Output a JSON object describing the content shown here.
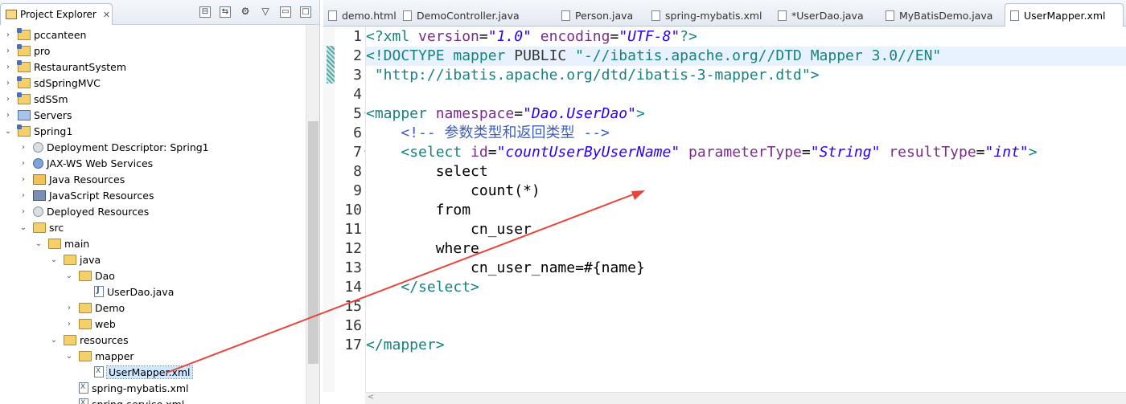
{
  "explorer": {
    "title": "Project Explorer",
    "close": "✕",
    "toolbar": {
      "collapse_all": "⊟",
      "link_editor": "⇆",
      "view_menu": "▽",
      "minimize": "▭",
      "maximize": "□"
    },
    "tree": [
      {
        "label": "pccanteen",
        "twisty": "›",
        "icon": "project"
      },
      {
        "label": "pro",
        "twisty": "›",
        "icon": "project"
      },
      {
        "label": "RestaurantSystem",
        "twisty": "›",
        "icon": "project"
      },
      {
        "label": "sdSpringMVC",
        "twisty": "›",
        "icon": "project"
      },
      {
        "label": "sdSSm",
        "twisty": "›",
        "icon": "project"
      },
      {
        "label": "Servers",
        "twisty": "›",
        "icon": "server"
      },
      {
        "label": "Spring1",
        "twisty": "⌄",
        "icon": "project"
      },
      {
        "label": "Deployment Descriptor: Spring1",
        "twisty": "›",
        "icon": "dep"
      },
      {
        "label": "JAX-WS Web Services",
        "twisty": "›",
        "icon": "globe"
      },
      {
        "label": "Java Resources",
        "twisty": "›",
        "icon": "coffee"
      },
      {
        "label": "JavaScript Resources",
        "twisty": "›",
        "icon": "js"
      },
      {
        "label": "Deployed Resources",
        "twisty": "›",
        "icon": "dep"
      },
      {
        "label": "src",
        "twisty": "⌄",
        "icon": "folder"
      },
      {
        "label": "main",
        "twisty": "⌄",
        "icon": "folder"
      },
      {
        "label": "java",
        "twisty": "⌄",
        "icon": "folder"
      },
      {
        "label": "Dao",
        "twisty": "⌄",
        "icon": "folder"
      },
      {
        "label": "UserDao.java",
        "twisty": "",
        "icon": "java"
      },
      {
        "label": "Demo",
        "twisty": "›",
        "icon": "folder"
      },
      {
        "label": "web",
        "twisty": "›",
        "icon": "folder"
      },
      {
        "label": "resources",
        "twisty": "⌄",
        "icon": "folder"
      },
      {
        "label": "mapper",
        "twisty": "⌄",
        "icon": "folder"
      },
      {
        "label": "UserMapper.xml",
        "twisty": "",
        "icon": "xml",
        "selected": true
      },
      {
        "label": "spring-mybatis.xml",
        "twisty": "",
        "icon": "xml"
      },
      {
        "label": "spring-service.xml",
        "twisty": "",
        "icon": "xml"
      }
    ]
  },
  "editor": {
    "tabs": [
      {
        "label": "demo.html",
        "active": false
      },
      {
        "label": "DemoController.java",
        "active": false
      },
      {
        "label": "Person.java",
        "active": false
      },
      {
        "label": "spring-mybatis.xml",
        "active": false
      },
      {
        "label": "*UserDao.java",
        "active": false
      },
      {
        "label": "MyBatisDemo.java",
        "active": false
      },
      {
        "label": "UserMapper.xml",
        "active": true
      }
    ],
    "line_numbers": [
      "1",
      "2",
      "3",
      "4",
      "5",
      "6",
      "7",
      "8",
      "9",
      "10",
      "11",
      "12",
      "13",
      "14",
      "15",
      "16",
      "17"
    ],
    "lines": [
      [
        {
          "c": "t-tag",
          "t": "<?xml "
        },
        {
          "c": "t-kw",
          "t": "version"
        },
        {
          "c": "t-txt",
          "t": "="
        },
        {
          "c": "t-str",
          "t": "\"1.0\""
        },
        {
          "c": "t-txt",
          "t": " "
        },
        {
          "c": "t-kw",
          "t": "encoding"
        },
        {
          "c": "t-txt",
          "t": "="
        },
        {
          "c": "t-str",
          "t": "\"UTF-8\""
        },
        {
          "c": "t-tag",
          "t": "?>"
        }
      ],
      [
        {
          "c": "t-dt",
          "t": "<!DOCTYPE "
        },
        {
          "c": "t-dt",
          "t": "mapper "
        },
        {
          "c": "t-str2",
          "t": "PUBLIC"
        },
        {
          "c": "t-txt",
          "t": " "
        },
        {
          "c": "t-dt",
          "t": "\"-//ibatis.apache.org//DTD Mapper 3.0//EN\""
        }
      ],
      [
        {
          "c": "t-txt",
          "t": " "
        },
        {
          "c": "t-dt",
          "t": "\"http://ibatis.apache.org/dtd/ibatis-3-mapper.dtd\""
        },
        {
          "c": "t-dt",
          "t": ">"
        }
      ],
      [
        {
          "c": "t-txt",
          "t": ""
        }
      ],
      [
        {
          "c": "t-tag",
          "t": "<mapper "
        },
        {
          "c": "t-kw",
          "t": "namespace"
        },
        {
          "c": "t-txt",
          "t": "="
        },
        {
          "c": "t-str",
          "t": "\"Dao.UserDao\""
        },
        {
          "c": "t-tag",
          "t": ">"
        }
      ],
      [
        {
          "c": "t-txt",
          "t": "    "
        },
        {
          "c": "t-cm",
          "t": "<!-- 参数类型和返回类型 -->"
        }
      ],
      [
        {
          "c": "t-txt",
          "t": "    "
        },
        {
          "c": "t-tag",
          "t": "<select "
        },
        {
          "c": "t-kw",
          "t": "id"
        },
        {
          "c": "t-txt",
          "t": "="
        },
        {
          "c": "t-str",
          "t": "\"countUserByUserName\""
        },
        {
          "c": "t-txt",
          "t": " "
        },
        {
          "c": "t-kw",
          "t": "parameterType"
        },
        {
          "c": "t-txt",
          "t": "="
        },
        {
          "c": "t-str",
          "t": "\"String\""
        },
        {
          "c": "t-txt",
          "t": " "
        },
        {
          "c": "t-kw",
          "t": "resultType"
        },
        {
          "c": "t-txt",
          "t": "="
        },
        {
          "c": "t-str",
          "t": "\"int\""
        },
        {
          "c": "t-tag",
          "t": ">"
        }
      ],
      [
        {
          "c": "t-txt",
          "t": "        select"
        }
      ],
      [
        {
          "c": "t-txt",
          "t": "            count(*)"
        }
      ],
      [
        {
          "c": "t-txt",
          "t": "        from"
        }
      ],
      [
        {
          "c": "t-txt",
          "t": "            cn_user"
        }
      ],
      [
        {
          "c": "t-txt",
          "t": "        where"
        }
      ],
      [
        {
          "c": "t-txt",
          "t": "            cn_user_name=#{name}"
        }
      ],
      [
        {
          "c": "t-txt",
          "t": "    "
        },
        {
          "c": "t-tag",
          "t": "</select>"
        }
      ],
      [
        {
          "c": "t-txt",
          "t": ""
        }
      ],
      [
        {
          "c": "t-txt",
          "t": ""
        }
      ],
      [
        {
          "c": "t-tag",
          "t": "</mapper>"
        }
      ]
    ],
    "fold_markers": [
      "⊖",
      "⊖"
    ],
    "hscroll_arrow": "<"
  },
  "colors": {
    "annotation_arrow": "#e8453c",
    "current_line": "#e8f2fe",
    "selection": "#cde8ff"
  }
}
